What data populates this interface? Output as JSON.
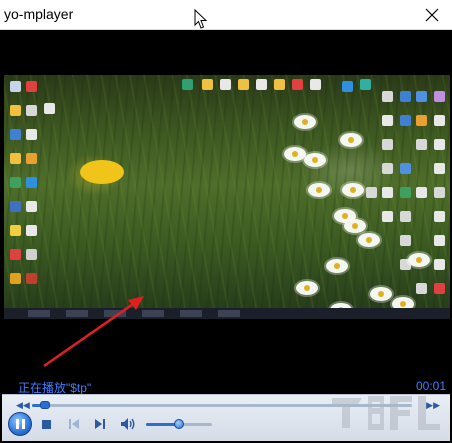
{
  "window": {
    "title": "yo-mplayer"
  },
  "player": {
    "status_text": "正在播放\"$tp\"",
    "elapsed_time": "00:01",
    "seek_position": 0.035,
    "volume_level": 0.5,
    "state": "playing"
  },
  "icons": {
    "close": "close-icon",
    "pause": "pause-icon",
    "stop": "stop-icon",
    "previous": "previous-track-icon",
    "next": "next-track-icon",
    "volume": "volume-icon",
    "seek_back": "rewind-icon",
    "seek_forward": "fast-forward-icon"
  },
  "colors": {
    "accent": "#2c6fd4",
    "status_text": "#3f7dff",
    "annotation_arrow": "#e02020"
  }
}
